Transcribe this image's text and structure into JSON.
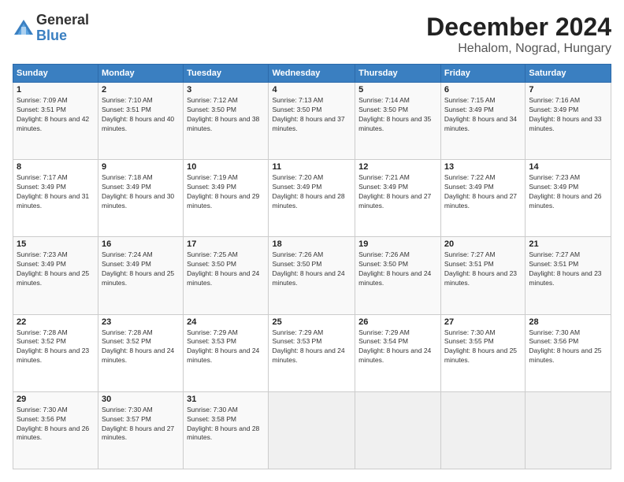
{
  "header": {
    "logo_general": "General",
    "logo_blue": "Blue",
    "month": "December 2024",
    "location": "Hehalom, Nograd, Hungary"
  },
  "days_of_week": [
    "Sunday",
    "Monday",
    "Tuesday",
    "Wednesday",
    "Thursday",
    "Friday",
    "Saturday"
  ],
  "weeks": [
    [
      {
        "day": "1",
        "sunrise": "7:09 AM",
        "sunset": "3:51 PM",
        "daylight": "8 hours and 42 minutes."
      },
      {
        "day": "2",
        "sunrise": "7:10 AM",
        "sunset": "3:51 PM",
        "daylight": "8 hours and 40 minutes."
      },
      {
        "day": "3",
        "sunrise": "7:12 AM",
        "sunset": "3:50 PM",
        "daylight": "8 hours and 38 minutes."
      },
      {
        "day": "4",
        "sunrise": "7:13 AM",
        "sunset": "3:50 PM",
        "daylight": "8 hours and 37 minutes."
      },
      {
        "day": "5",
        "sunrise": "7:14 AM",
        "sunset": "3:50 PM",
        "daylight": "8 hours and 35 minutes."
      },
      {
        "day": "6",
        "sunrise": "7:15 AM",
        "sunset": "3:49 PM",
        "daylight": "8 hours and 34 minutes."
      },
      {
        "day": "7",
        "sunrise": "7:16 AM",
        "sunset": "3:49 PM",
        "daylight": "8 hours and 33 minutes."
      }
    ],
    [
      {
        "day": "8",
        "sunrise": "7:17 AM",
        "sunset": "3:49 PM",
        "daylight": "8 hours and 31 minutes."
      },
      {
        "day": "9",
        "sunrise": "7:18 AM",
        "sunset": "3:49 PM",
        "daylight": "8 hours and 30 minutes."
      },
      {
        "day": "10",
        "sunrise": "7:19 AM",
        "sunset": "3:49 PM",
        "daylight": "8 hours and 29 minutes."
      },
      {
        "day": "11",
        "sunrise": "7:20 AM",
        "sunset": "3:49 PM",
        "daylight": "8 hours and 28 minutes."
      },
      {
        "day": "12",
        "sunrise": "7:21 AM",
        "sunset": "3:49 PM",
        "daylight": "8 hours and 27 minutes."
      },
      {
        "day": "13",
        "sunrise": "7:22 AM",
        "sunset": "3:49 PM",
        "daylight": "8 hours and 27 minutes."
      },
      {
        "day": "14",
        "sunrise": "7:23 AM",
        "sunset": "3:49 PM",
        "daylight": "8 hours and 26 minutes."
      }
    ],
    [
      {
        "day": "15",
        "sunrise": "7:23 AM",
        "sunset": "3:49 PM",
        "daylight": "8 hours and 25 minutes."
      },
      {
        "day": "16",
        "sunrise": "7:24 AM",
        "sunset": "3:49 PM",
        "daylight": "8 hours and 25 minutes."
      },
      {
        "day": "17",
        "sunrise": "7:25 AM",
        "sunset": "3:50 PM",
        "daylight": "8 hours and 24 minutes."
      },
      {
        "day": "18",
        "sunrise": "7:26 AM",
        "sunset": "3:50 PM",
        "daylight": "8 hours and 24 minutes."
      },
      {
        "day": "19",
        "sunrise": "7:26 AM",
        "sunset": "3:50 PM",
        "daylight": "8 hours and 24 minutes."
      },
      {
        "day": "20",
        "sunrise": "7:27 AM",
        "sunset": "3:51 PM",
        "daylight": "8 hours and 23 minutes."
      },
      {
        "day": "21",
        "sunrise": "7:27 AM",
        "sunset": "3:51 PM",
        "daylight": "8 hours and 23 minutes."
      }
    ],
    [
      {
        "day": "22",
        "sunrise": "7:28 AM",
        "sunset": "3:52 PM",
        "daylight": "8 hours and 23 minutes."
      },
      {
        "day": "23",
        "sunrise": "7:28 AM",
        "sunset": "3:52 PM",
        "daylight": "8 hours and 24 minutes."
      },
      {
        "day": "24",
        "sunrise": "7:29 AM",
        "sunset": "3:53 PM",
        "daylight": "8 hours and 24 minutes."
      },
      {
        "day": "25",
        "sunrise": "7:29 AM",
        "sunset": "3:53 PM",
        "daylight": "8 hours and 24 minutes."
      },
      {
        "day": "26",
        "sunrise": "7:29 AM",
        "sunset": "3:54 PM",
        "daylight": "8 hours and 24 minutes."
      },
      {
        "day": "27",
        "sunrise": "7:30 AM",
        "sunset": "3:55 PM",
        "daylight": "8 hours and 25 minutes."
      },
      {
        "day": "28",
        "sunrise": "7:30 AM",
        "sunset": "3:56 PM",
        "daylight": "8 hours and 25 minutes."
      }
    ],
    [
      {
        "day": "29",
        "sunrise": "7:30 AM",
        "sunset": "3:56 PM",
        "daylight": "8 hours and 26 minutes."
      },
      {
        "day": "30",
        "sunrise": "7:30 AM",
        "sunset": "3:57 PM",
        "daylight": "8 hours and 27 minutes."
      },
      {
        "day": "31",
        "sunrise": "7:30 AM",
        "sunset": "3:58 PM",
        "daylight": "8 hours and 28 minutes."
      },
      null,
      null,
      null,
      null
    ]
  ]
}
